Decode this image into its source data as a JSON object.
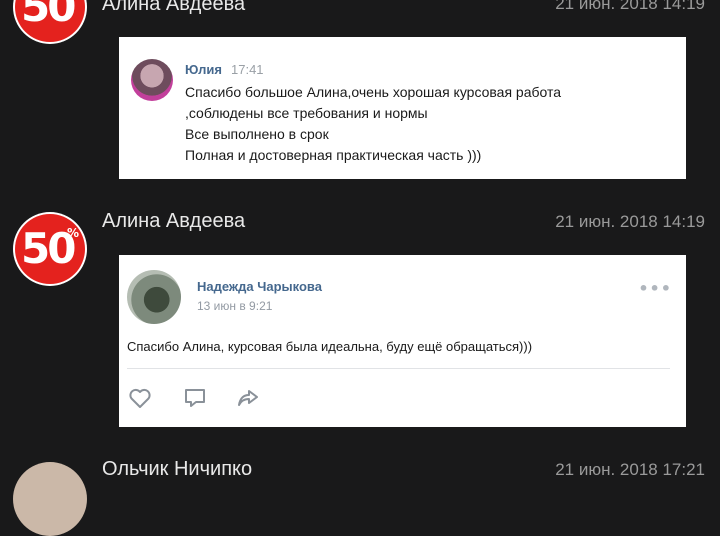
{
  "messages": [
    {
      "sender": "Алина Авдеева",
      "time": "21 июн. 2018 14:19",
      "forwarded": {
        "author": "Юлия",
        "time": "17:41",
        "lines": [
          "Спасибо большое Алина,очень хорошая курсовая работа",
          ",соблюдены все требования и нормы",
          "Все выполнено в срок",
          "Полная и достоверная практическая часть )))"
        ]
      }
    },
    {
      "sender": "Алина Авдеева",
      "time": "21 июн. 2018 14:19",
      "post": {
        "author": "Надежда Чарыкова",
        "date": "13 июн в 9:21",
        "text": "Спасибо Алина, курсовая была идеальна, буду ещё обращаться)))",
        "more": "•••"
      }
    },
    {
      "sender": "Ольчик Ничипко",
      "time": "21 июн. 2018 17:21"
    }
  ],
  "avatar_badge": {
    "number": "50",
    "symbol": "%"
  },
  "colors": {
    "background": "#19191a",
    "badge_red": "#e4221e",
    "link_blue": "#45688e"
  }
}
